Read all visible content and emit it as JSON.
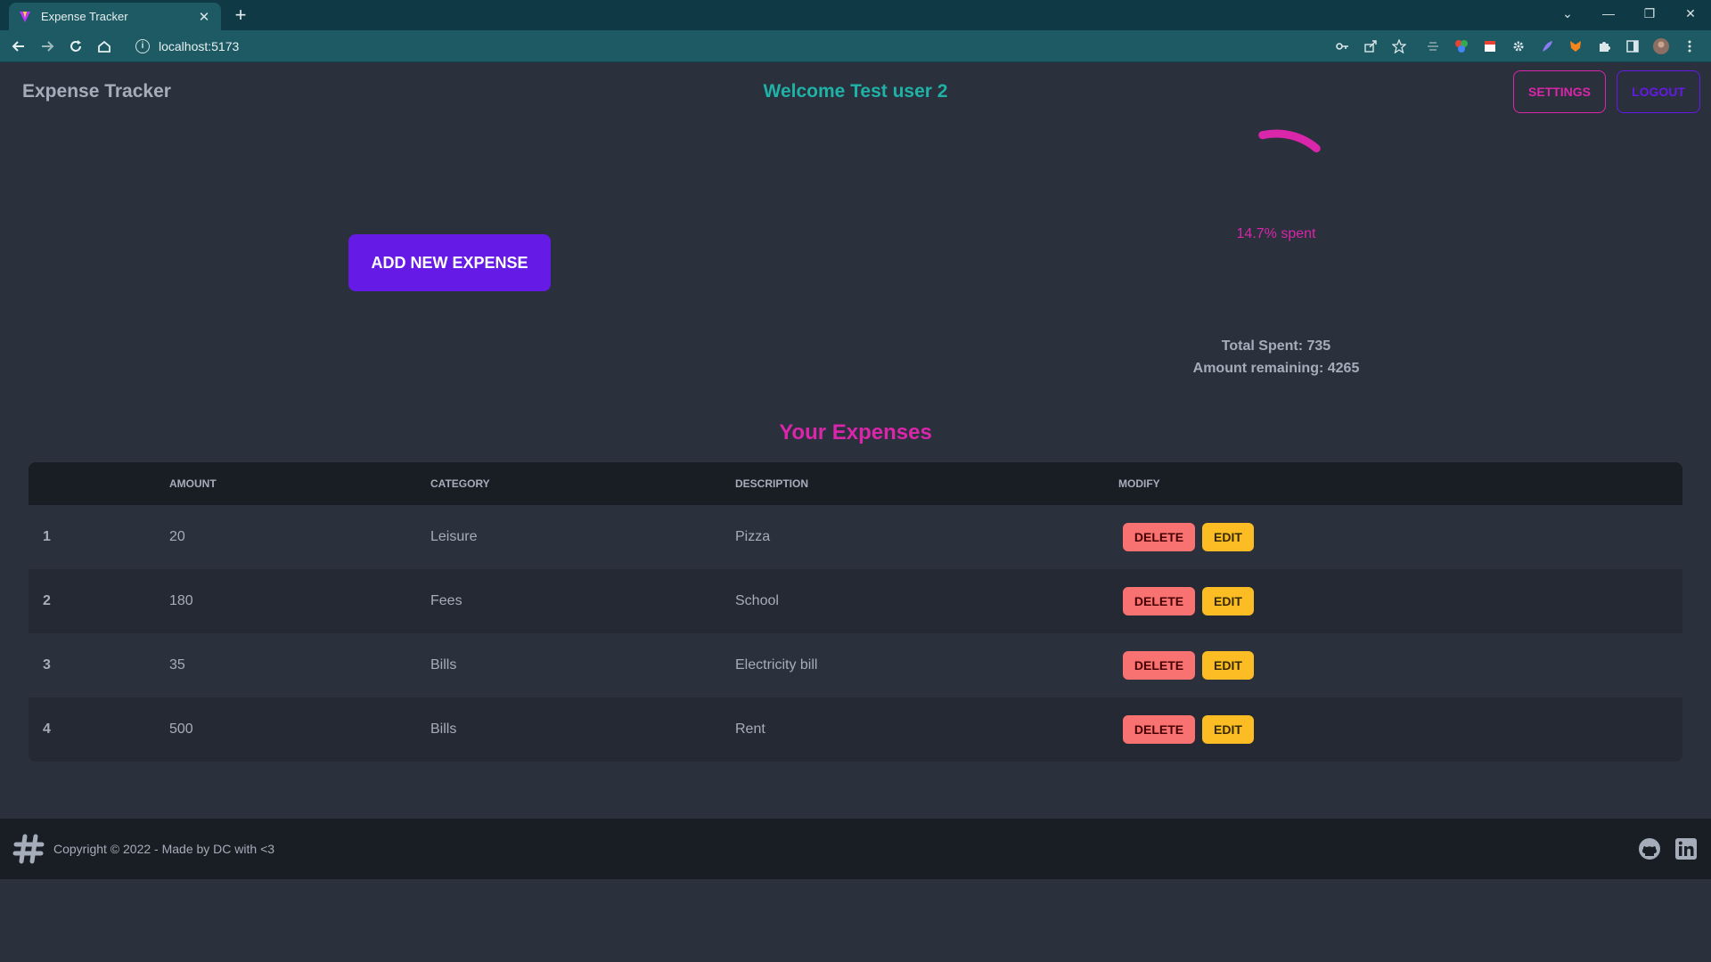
{
  "browser": {
    "tab_title": "Expense Tracker",
    "url": "localhost:5173"
  },
  "header": {
    "app_title": "Expense Tracker",
    "welcome": "Welcome Test user 2",
    "settings_label": "SETTINGS",
    "logout_label": "LOGOUT"
  },
  "actions": {
    "add_expense_label": "ADD NEW EXPENSE"
  },
  "summary": {
    "progress_percent": 14.7,
    "progress_label": "14.7% spent",
    "total_spent": "Total Spent: 735",
    "amount_remaining": "Amount remaining: 4265"
  },
  "expenses": {
    "title": "Your Expenses",
    "columns": [
      "",
      "AMOUNT",
      "CATEGORY",
      "DESCRIPTION",
      "MODIFY"
    ],
    "delete_label": "DELETE",
    "edit_label": "EDIT",
    "rows": [
      {
        "index": "1",
        "amount": "20",
        "category": "Leisure",
        "description": "Pizza"
      },
      {
        "index": "2",
        "amount": "180",
        "category": "Fees",
        "description": "School"
      },
      {
        "index": "3",
        "amount": "35",
        "category": "Bills",
        "description": "Electricity bill"
      },
      {
        "index": "4",
        "amount": "500",
        "category": "Bills",
        "description": "Rent"
      }
    ]
  },
  "footer": {
    "copyright": "Copyright © 2022 - Made by DC with <3"
  },
  "colors": {
    "primary": "#661ae6",
    "secondary": "#d926aa",
    "accent": "#1fb2a6",
    "error": "#f87272",
    "warning": "#fbbd23"
  }
}
